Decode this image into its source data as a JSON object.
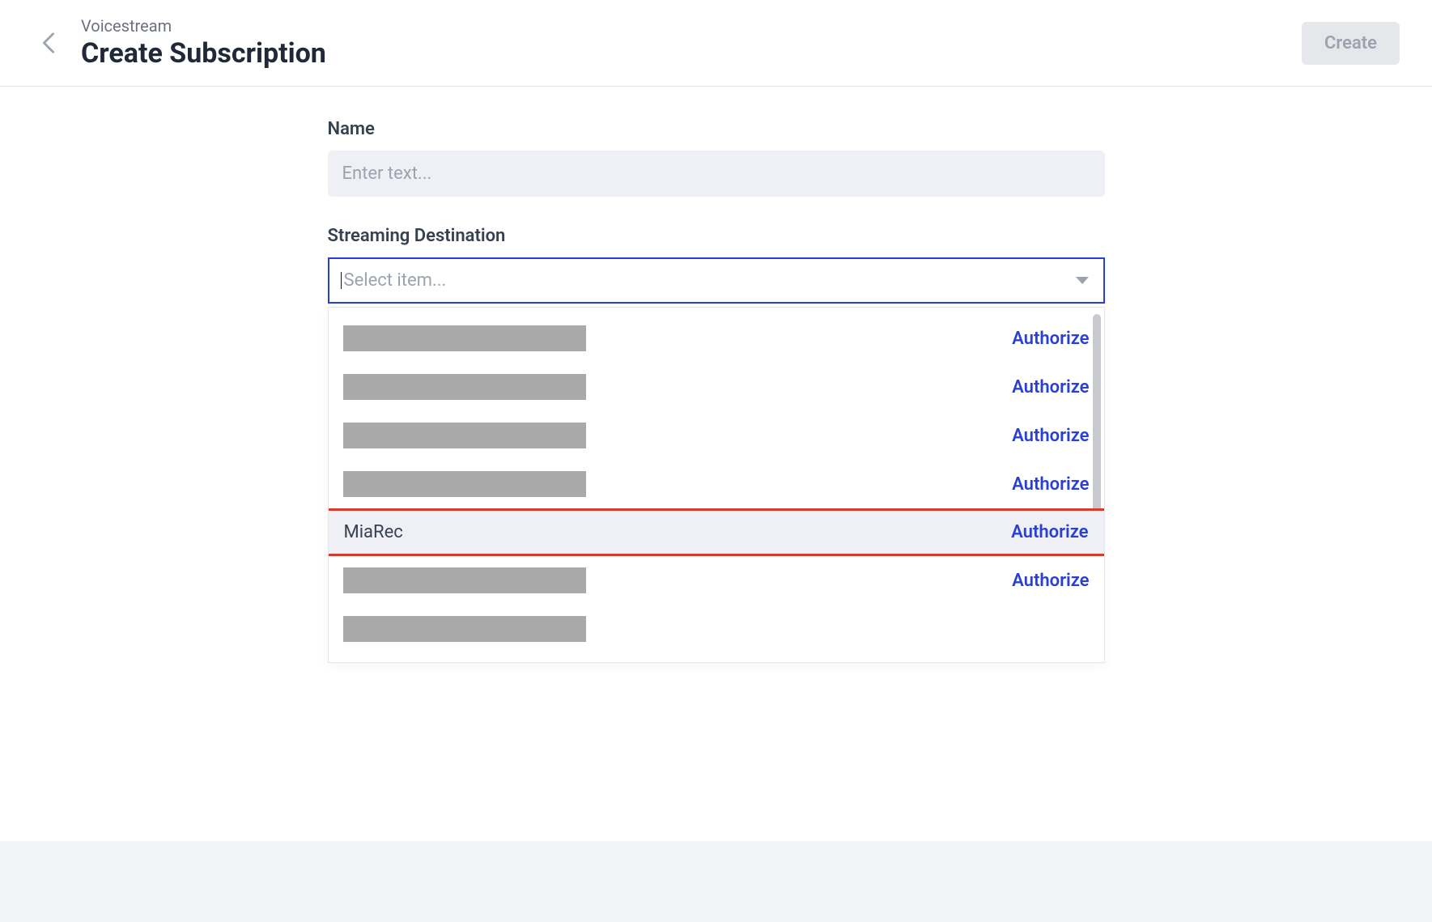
{
  "header": {
    "breadcrumb": "Voicestream",
    "title": "Create Subscription",
    "create_label": "Create"
  },
  "form": {
    "name_label": "Name",
    "name_placeholder": "Enter text...",
    "dest_label": "Streaming Destination",
    "dest_placeholder": "Select item..."
  },
  "dropdown": {
    "authorize_label": "Authorize",
    "items": [
      {
        "label": "",
        "redacted": true,
        "authorize": true
      },
      {
        "label": "",
        "redacted": true,
        "authorize": true
      },
      {
        "label": "",
        "redacted": true,
        "authorize": true
      },
      {
        "label": "",
        "redacted": true,
        "authorize": true
      },
      {
        "label": "MiaRec",
        "redacted": false,
        "authorize": true,
        "highlighted": true
      },
      {
        "label": "",
        "redacted": true,
        "authorize": true
      },
      {
        "label": "",
        "redacted": true,
        "authorize": false
      },
      {
        "label": "",
        "redacted": true,
        "authorize": true
      }
    ]
  }
}
